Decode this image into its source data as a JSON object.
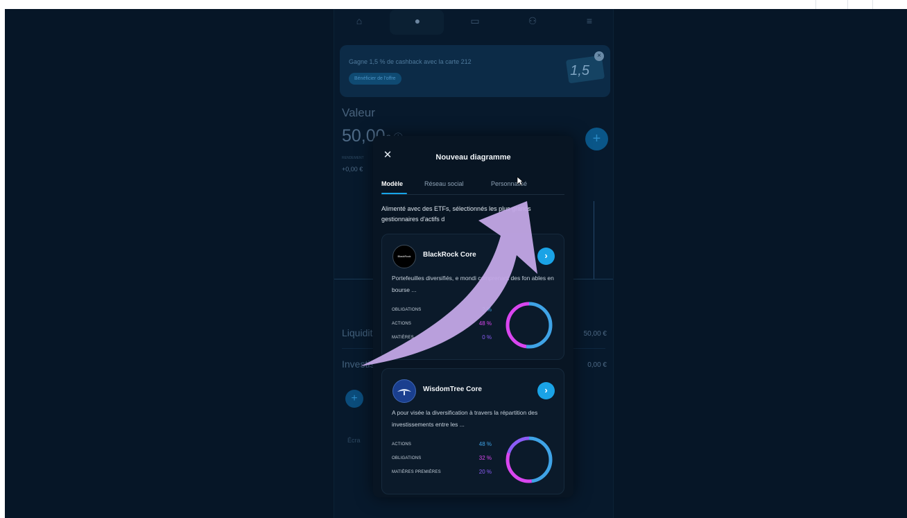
{
  "nav": {
    "icons": [
      "home-icon",
      "portfolio-icon",
      "card-icon",
      "community-icon",
      "menu-icon"
    ]
  },
  "promo": {
    "text": "Gagne 1,5 % de cashback avec la carte 212",
    "button": "Bénéficier de l'offre",
    "card_number": "1,5",
    "close": "×"
  },
  "summary": {
    "label": "Valeur",
    "amount_main": "50,00",
    "amount_unit": "€",
    "rendement_label": "RENDEMENT",
    "rendement_value": "+0,00 €",
    "add": "+"
  },
  "rows": [
    {
      "label": "Liquidit",
      "value": "50,00 €"
    },
    {
      "label": "Investis",
      "value": "0,00 €"
    }
  ],
  "footer_link": "Écra",
  "modal": {
    "close": "✕",
    "title": "Nouveau diagramme",
    "tabs": [
      "Modèle",
      "Réseau social",
      "Personnalisé"
    ],
    "intro": "Alimenté avec des ETFs, sélectionnés     les plus grands gestionnaires d'actifs d",
    "cards": [
      {
        "name": "BlackRock Core",
        "logo_text": "BlackRock",
        "description": "Portefeuilles diversifiés,          e mondi comprenant des fon              ables en bourse ...",
        "allocations": [
          {
            "label": "OBLIGATIONS",
            "value": "2 %",
            "color": "#3fa3e6",
            "fraction": 0.52
          },
          {
            "label": "ACTIONS",
            "value": "48 %",
            "color": "#d946ef",
            "fraction": 0.48
          },
          {
            "label": "MATIÈRES",
            "value": "0 %",
            "color": "#8b5cf6",
            "fraction": 0
          }
        ]
      },
      {
        "name": "WisdomTree Core",
        "logo_text": "",
        "description": "A pour visée la diversification à travers la répartition des investissements entre les ...",
        "allocations": [
          {
            "label": "ACTIONS",
            "value": "48 %",
            "color": "#3fa3e6",
            "fraction": 0.48
          },
          {
            "label": "OBLIGATIONS",
            "value": "32 %",
            "color": "#d946ef",
            "fraction": 0.32
          },
          {
            "label": "MATIÈRES PREMIÈRES",
            "value": "20 %",
            "color": "#8b5cf6",
            "fraction": 0.2
          }
        ]
      }
    ]
  },
  "overlay": {
    "arrow_color": "#c3a7e6"
  }
}
